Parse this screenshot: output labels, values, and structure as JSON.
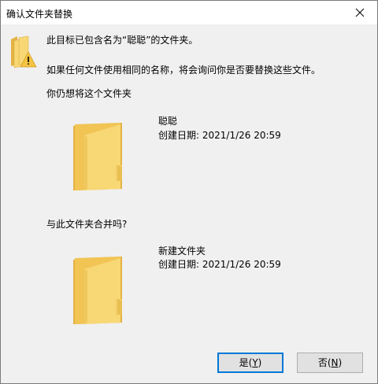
{
  "window": {
    "title": "确认文件夹替换"
  },
  "message": {
    "line1": "此目标已包含名为“聪聪”的文件夹。",
    "line2": "如果任何文件使用相同的名称，将会询问你是否要替换这些文件。",
    "line3": "你仍想将这个文件夹"
  },
  "target_folder": {
    "name": "聪聪",
    "date": "创建日期: 2021/1/26 20:59",
    "icon": "folder-icon"
  },
  "merge_question": "与此文件夹合并吗?",
  "source_folder": {
    "name": "新建文件夹",
    "date": "创建日期: 2021/1/26 20:59",
    "icon": "folder-icon"
  },
  "buttons": {
    "yes_label": "是(",
    "yes_key": "Y",
    "yes_end": ")",
    "no_label": "否(",
    "no_key": "N",
    "no_end": ")"
  },
  "colors": {
    "folder_front": "#f8d775",
    "folder_back": "#e3b343",
    "warning": "#f6c342",
    "accent": "#0078d7"
  }
}
